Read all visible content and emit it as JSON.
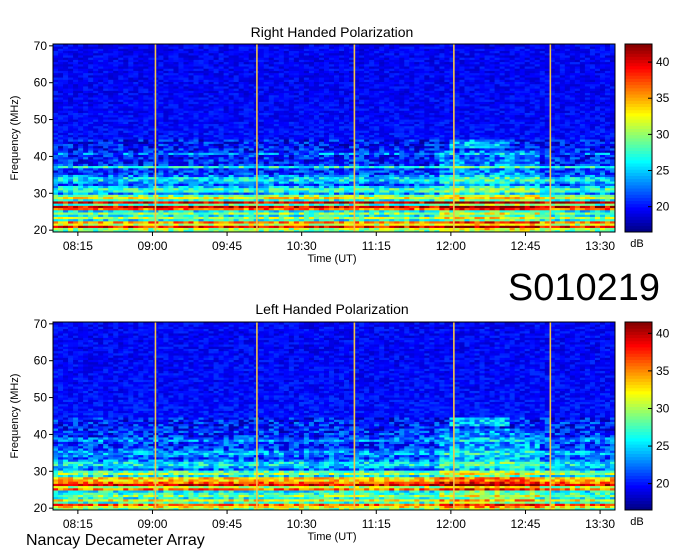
{
  "chart_data": [
    {
      "type": "heatmap",
      "title": "Right Handed Polarization",
      "xlabel": "Time (UT)",
      "ylabel": "Frequency (MHz)",
      "x_ticks": [
        "08:15",
        "09:00",
        "09:45",
        "10:30",
        "11:15",
        "12:00",
        "12:45",
        "13:30"
      ],
      "x_tick_hours": [
        8.25,
        9.0,
        9.75,
        10.5,
        11.25,
        12.0,
        12.75,
        13.5
      ],
      "xlim": [
        8.0,
        13.65
      ],
      "y_ticks": [
        20,
        30,
        40,
        50,
        60,
        70
      ],
      "ylim": [
        19.5,
        70.5
      ],
      "colorbar": {
        "label": "dB",
        "ticks": [
          20,
          25,
          30,
          35,
          40
        ],
        "range": [
          16.5,
          42.5
        ]
      },
      "vertical_lines_hours": [
        9.03,
        10.05,
        11.03,
        12.03,
        13.0
      ],
      "bands": [
        {
          "freq": 21.0,
          "width": 0.9,
          "level": 39
        },
        {
          "freq": 22.2,
          "width": 0.5,
          "level": 36
        },
        {
          "freq": 23.5,
          "width": 0.8,
          "level": 31
        },
        {
          "freq": 24.7,
          "width": 0.8,
          "level": 30
        },
        {
          "freq": 26.2,
          "width": 0.9,
          "level": 41
        },
        {
          "freq": 27.6,
          "width": 0.6,
          "level": 40
        },
        {
          "freq": 28.9,
          "width": 1.0,
          "level": 33
        },
        {
          "freq": 31.0,
          "width": 1.4,
          "level": 28
        },
        {
          "freq": 33.8,
          "width": 1.6,
          "level": 26
        },
        {
          "freq": 37.2,
          "width": 0.6,
          "level": 27
        },
        {
          "freq": 41.0,
          "width": 0.5,
          "level": 24
        }
      ]
    },
    {
      "type": "heatmap",
      "title": "Left Handed Polarization",
      "xlabel": "Time (UT)",
      "ylabel": "Frequency (MHz)",
      "x_ticks": [
        "08:15",
        "09:00",
        "09:45",
        "10:30",
        "11:15",
        "12:00",
        "12:45",
        "13:30"
      ],
      "x_tick_hours": [
        8.25,
        9.0,
        9.75,
        10.5,
        11.25,
        12.0,
        12.75,
        13.5
      ],
      "xlim": [
        8.0,
        13.65
      ],
      "y_ticks": [
        20,
        30,
        40,
        50,
        60,
        70
      ],
      "ylim": [
        19.5,
        70.5
      ],
      "colorbar": {
        "label": "dB",
        "ticks": [
          20,
          25,
          30,
          35,
          40
        ],
        "range": [
          16.5,
          41.5
        ]
      },
      "vertical_lines_hours": [
        9.03,
        10.05,
        11.03,
        12.03,
        13.0
      ],
      "bands": [
        {
          "freq": 20.8,
          "width": 0.8,
          "level": 37
        },
        {
          "freq": 22.0,
          "width": 0.5,
          "level": 35
        },
        {
          "freq": 23.6,
          "width": 0.8,
          "level": 30
        },
        {
          "freq": 25.3,
          "width": 0.8,
          "level": 36
        },
        {
          "freq": 26.6,
          "width": 0.9,
          "level": 40
        },
        {
          "freq": 27.9,
          "width": 0.6,
          "level": 38
        },
        {
          "freq": 29.5,
          "width": 1.1,
          "level": 30
        },
        {
          "freq": 32.0,
          "width": 1.6,
          "level": 26
        },
        {
          "freq": 35.0,
          "width": 1.6,
          "level": 24
        },
        {
          "freq": 38.5,
          "width": 1.2,
          "level": 23
        }
      ]
    }
  ],
  "annotations": {
    "observation_id": "S010219",
    "instrument": "Nancay Decameter Array"
  }
}
